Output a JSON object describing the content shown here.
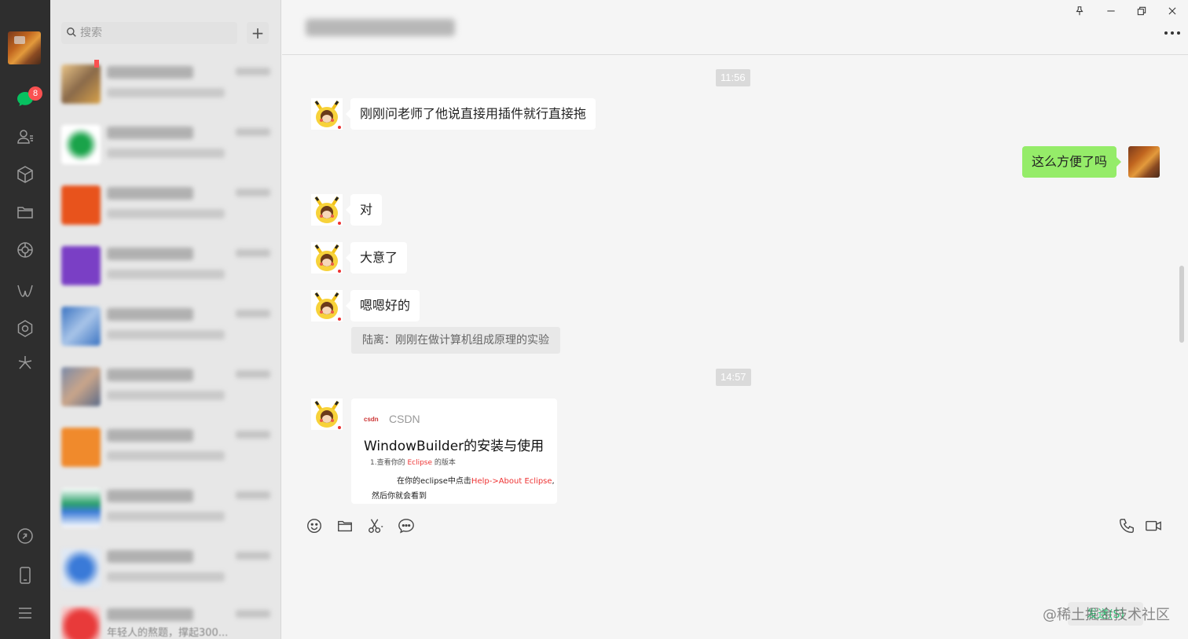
{
  "sidebar": {
    "badge_count": "8",
    "icons": [
      "chat-icon",
      "contacts-icon",
      "favorites-icon",
      "files-icon",
      "moments-icon",
      "channels-icon",
      "mini-programs-icon",
      "search-icon",
      "phone-icon",
      "menu-icon"
    ]
  },
  "list": {
    "search_placeholder": "搜索",
    "add_label": "+",
    "last_item_preview": "年轻人的熬题，撑起300..."
  },
  "chat": {
    "timestamps": [
      "11:56",
      "14:57"
    ],
    "messages": [
      {
        "side": "left",
        "text": "刚刚问老师了他说直接用插件就行直接拖"
      },
      {
        "side": "right",
        "text": "这么方便了吗"
      },
      {
        "side": "left",
        "text": "对"
      },
      {
        "side": "left",
        "text": "大意了"
      },
      {
        "side": "left",
        "text": "嗯嗯好的"
      }
    ],
    "quote": "陆离：刚刚在做计算机组成原理的实验",
    "card": {
      "source": "CSDN",
      "source_logo": "csdn",
      "title": "WindowBuilder的安装与使用",
      "line1_prefix": "1.查看你的 ",
      "line1_red": "Eclipse",
      "line1_suffix": " 的版本",
      "line2_prefix": "在你的eclipse中点击",
      "line2_red": "Help->About Eclipse",
      "line2_suffix": ",",
      "line3": "然后你就会看到"
    }
  },
  "footer": {
    "send_label": "发送(S)",
    "watermark": "@稀土掘金技术社区"
  },
  "colors": {
    "rail_bg": "#2e2e2e",
    "list_bg": "#e7e7e7",
    "chat_bg": "#f5f5f5",
    "my_bubble": "#95ec69",
    "badge": "#fa5151",
    "accent": "#07c160"
  }
}
